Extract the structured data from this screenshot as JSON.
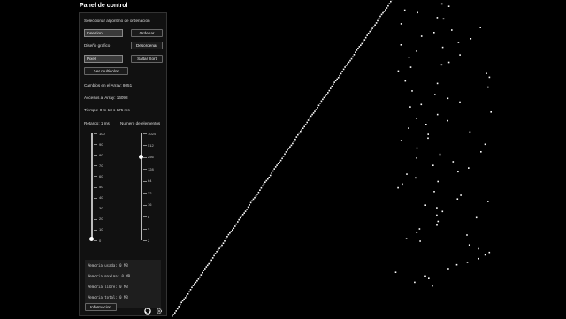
{
  "title": "Panel de control",
  "controls": {
    "algorithm_label": "Seleccionar algoritmo de ordenacion",
    "algorithm_value": "Insertion",
    "sort_button": "Ordenar",
    "design_label": "Diseño grafico",
    "shuffle_button": "Desordenar",
    "design_value": "Pixel",
    "skip_button": "Saltar Sort",
    "multicolor_button": "Ver multicolor"
  },
  "stats": {
    "changes": "Cambios en el Array: 8051",
    "accesses": "Accesos al Array: 16098",
    "time": "Tiempo: 0 m 13 s 175 ms"
  },
  "delay": {
    "label": "Retardo: 1 ms",
    "ticks": [
      "100",
      "90",
      "80",
      "70",
      "60",
      "50",
      "40",
      "30",
      "20",
      "10",
      "0"
    ],
    "value_percent": 1
  },
  "elements": {
    "label": "Numero de elementos",
    "ticks": [
      "1024",
      "512",
      "256",
      "128",
      "64",
      "32",
      "16",
      "8",
      "4",
      "2"
    ],
    "value": 256
  },
  "memory": {
    "used": "Memoria usada: 0 MB",
    "max": "Memoria maxima: 0 MB",
    "free": "Memoria libre: 0 MB",
    "total": "Memoria total: 0 MB"
  },
  "info_button": "Informacion",
  "icons": {
    "github": "github-icon",
    "settings": "gear-icon"
  },
  "chart_data": {
    "type": "scatter",
    "description_values": {
      "sorted_count": 170,
      "unsorted_count": 86,
      "total": 256
    },
    "unsorted_values": [
      252,
      250,
      247,
      245,
      241,
      240,
      236,
      233,
      231,
      229,
      226,
      224,
      221,
      219,
      217,
      214,
      211,
      209,
      205,
      203,
      201,
      198,
      196,
      193,
      190,
      188,
      185,
      182,
      179,
      176,
      173,
      171,
      169,
      165,
      163,
      160,
      158,
      155,
      152,
      149,
      147,
      144,
      142,
      139,
      136,
      133,
      131,
      128,
      125,
      122,
      120,
      117,
      115,
      112,
      109,
      107,
      104,
      101,
      98,
      95,
      93,
      90,
      88,
      85,
      82,
      80,
      77,
      74,
      71,
      68,
      66,
      63,
      61,
      58,
      55,
      52,
      50,
      47,
      44,
      42,
      39,
      36,
      33,
      31,
      28,
      25
    ]
  }
}
